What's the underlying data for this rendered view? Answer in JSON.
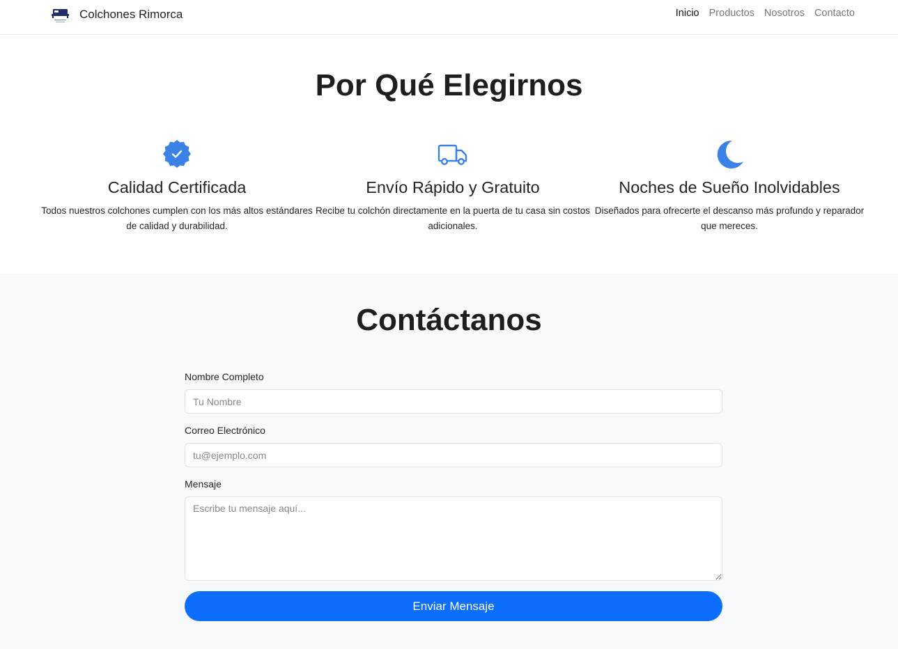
{
  "navbar": {
    "brand_name": "Colchones Rimorca",
    "links": [
      {
        "label": "Inicio",
        "active": true
      },
      {
        "label": "Productos",
        "active": false
      },
      {
        "label": "Nosotros",
        "active": false
      },
      {
        "label": "Contacto",
        "active": false
      }
    ]
  },
  "features": {
    "title": "Por Qué Elegirnos",
    "items": [
      {
        "icon": "certified-badge-icon",
        "title": "Calidad Certificada",
        "description": "Todos nuestros colchones cumplen con los más altos estándares de calidad y durabilidad."
      },
      {
        "icon": "truck-icon",
        "title": "Envío Rápido y Gratuito",
        "description": "Recibe tu colchón directamente en la puerta de tu casa sin costos adicionales."
      },
      {
        "icon": "moon-icon",
        "title": "Noches de Sueño Inolvidables",
        "description": "Diseñados para ofrecerte el descanso más profundo y reparador que mereces."
      }
    ]
  },
  "contact": {
    "title": "Contáctanos",
    "name_label": "Nombre Completo",
    "name_placeholder": "Tu Nombre",
    "email_label": "Correo Electrónico",
    "email_placeholder": "tu@ejemplo.com",
    "message_label": "Mensaje",
    "message_placeholder": "Escribe tu mensaje aquí...",
    "submit_label": "Enviar Mensaje"
  },
  "colors": {
    "accent": "#3b82e6",
    "button": "#0d6efd",
    "section_bg": "#f8f9fa"
  }
}
